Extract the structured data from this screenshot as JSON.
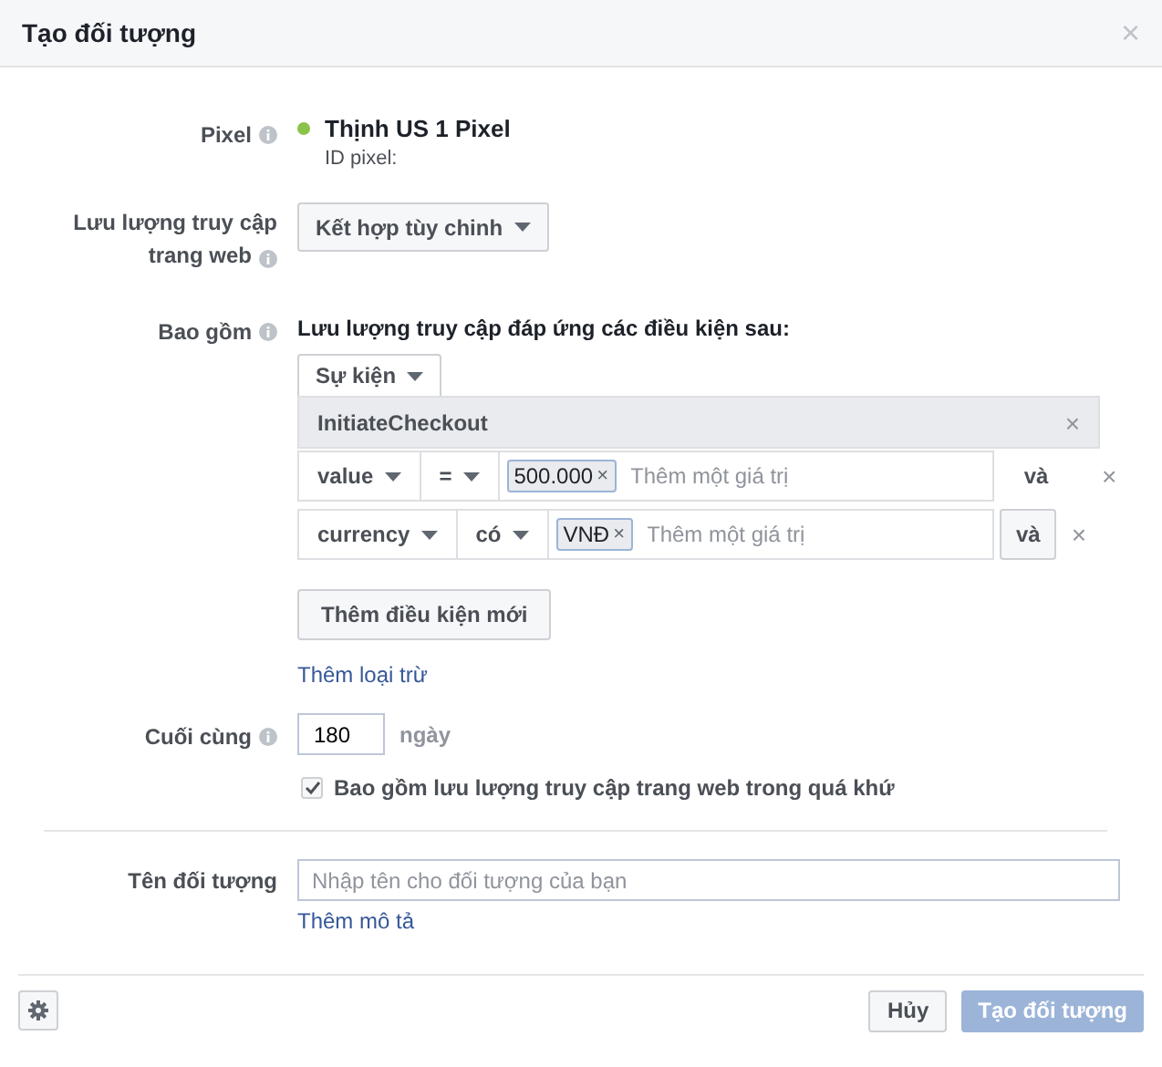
{
  "dialog": {
    "title": "Tạo đối tượng",
    "close": "×"
  },
  "pixel": {
    "label": "Pixel",
    "name": "Thịnh US 1 Pixel",
    "id_label": "ID pixel:"
  },
  "traffic": {
    "label_lines": [
      "Lưu lượng truy cập",
      "trang web"
    ],
    "dropdown": "Kết hợp tùy chinh"
  },
  "include": {
    "label": "Bao gồm",
    "heading": "Lưu lượng truy cập đáp ứng các điều kiện sau:",
    "source_dropdown": "Sự kiện",
    "event": {
      "name": "InitiateCheckout",
      "remove": "×"
    },
    "conditions": [
      {
        "kind": "text",
        "field": "value",
        "operator": "=",
        "tokens": [
          {
            "text": "500.000",
            "remove": "×"
          }
        ],
        "placeholder": "Thêm một giá trị",
        "join": "và",
        "remove": "×"
      },
      {
        "kind": "button",
        "field": "currency",
        "operator": "có",
        "tokens": [
          {
            "text": "VNĐ",
            "remove": "×"
          }
        ],
        "placeholder": "Thêm một giá trị",
        "join": "và",
        "remove": "×"
      }
    ],
    "add_condition": "Thêm điều kiện mới",
    "add_exclusion": "Thêm loại trừ"
  },
  "retention": {
    "label": "Cuối cùng",
    "value": "180",
    "unit": "ngày",
    "past_traffic": {
      "label": "Bao gồm lưu lượng truy cập trang web trong quá khứ",
      "checked": true
    }
  },
  "audience_name": {
    "label": "Tên đối tượng",
    "placeholder": "Nhập tên cho đối tượng của bạn",
    "add_description": "Thêm mô tả"
  },
  "footer": {
    "cancel": "Hủy",
    "create": {
      "label": "Tạo đối tượng",
      "disabled": true
    }
  }
}
